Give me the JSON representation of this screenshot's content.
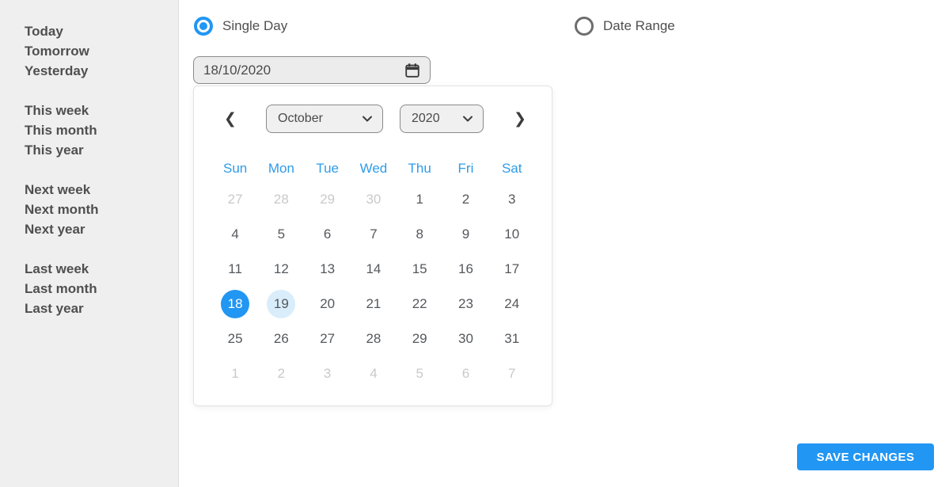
{
  "sidebar": {
    "groups": [
      {
        "items": [
          "Today",
          "Tomorrow",
          "Yesterday"
        ]
      },
      {
        "items": [
          "This week",
          "This month",
          "This year"
        ]
      },
      {
        "items": [
          "Next week",
          "Next month",
          "Next year"
        ]
      },
      {
        "items": [
          "Last week",
          "Last month",
          "Last year"
        ]
      }
    ]
  },
  "mode": {
    "single_day_label": "Single Day",
    "date_range_label": "Date Range",
    "selected": "Single Day"
  },
  "date_input": {
    "value": "18/10/2020",
    "icon": "calendar-icon"
  },
  "calendar": {
    "prev_icon": "❮",
    "next_icon": "❯",
    "month": "October",
    "year": "2020",
    "day_names": [
      "Sun",
      "Mon",
      "Tue",
      "Wed",
      "Thu",
      "Fri",
      "Sat"
    ],
    "selected_day": "18",
    "highlighted_day": "19",
    "weeks": [
      [
        {
          "d": "27",
          "muted": true
        },
        {
          "d": "28",
          "muted": true
        },
        {
          "d": "29",
          "muted": true
        },
        {
          "d": "30",
          "muted": true
        },
        {
          "d": "1"
        },
        {
          "d": "2"
        },
        {
          "d": "3"
        }
      ],
      [
        {
          "d": "4"
        },
        {
          "d": "5"
        },
        {
          "d": "6"
        },
        {
          "d": "7"
        },
        {
          "d": "8"
        },
        {
          "d": "9"
        },
        {
          "d": "10"
        }
      ],
      [
        {
          "d": "11"
        },
        {
          "d": "12"
        },
        {
          "d": "13"
        },
        {
          "d": "14"
        },
        {
          "d": "15"
        },
        {
          "d": "16"
        },
        {
          "d": "17"
        }
      ],
      [
        {
          "d": "18",
          "selected": true
        },
        {
          "d": "19",
          "today": true
        },
        {
          "d": "20"
        },
        {
          "d": "21"
        },
        {
          "d": "22"
        },
        {
          "d": "23"
        },
        {
          "d": "24"
        }
      ],
      [
        {
          "d": "25"
        },
        {
          "d": "26"
        },
        {
          "d": "27"
        },
        {
          "d": "28"
        },
        {
          "d": "29"
        },
        {
          "d": "30"
        },
        {
          "d": "31"
        }
      ],
      [
        {
          "d": "1",
          "muted": true
        },
        {
          "d": "2",
          "muted": true
        },
        {
          "d": "3",
          "muted": true
        },
        {
          "d": "4",
          "muted": true
        },
        {
          "d": "5",
          "muted": true
        },
        {
          "d": "6",
          "muted": true
        },
        {
          "d": "7",
          "muted": true
        }
      ]
    ]
  },
  "save_button": {
    "label": "SAVE CHANGES"
  },
  "colors": {
    "accent": "#2196f3",
    "accent_light": "#d9edfb",
    "day_name": "#2e9ce9",
    "muted_day": "#c9c9c9",
    "text": "#4f4f4f",
    "sidebar_bg": "#efefef",
    "input_bg": "#ececec"
  }
}
